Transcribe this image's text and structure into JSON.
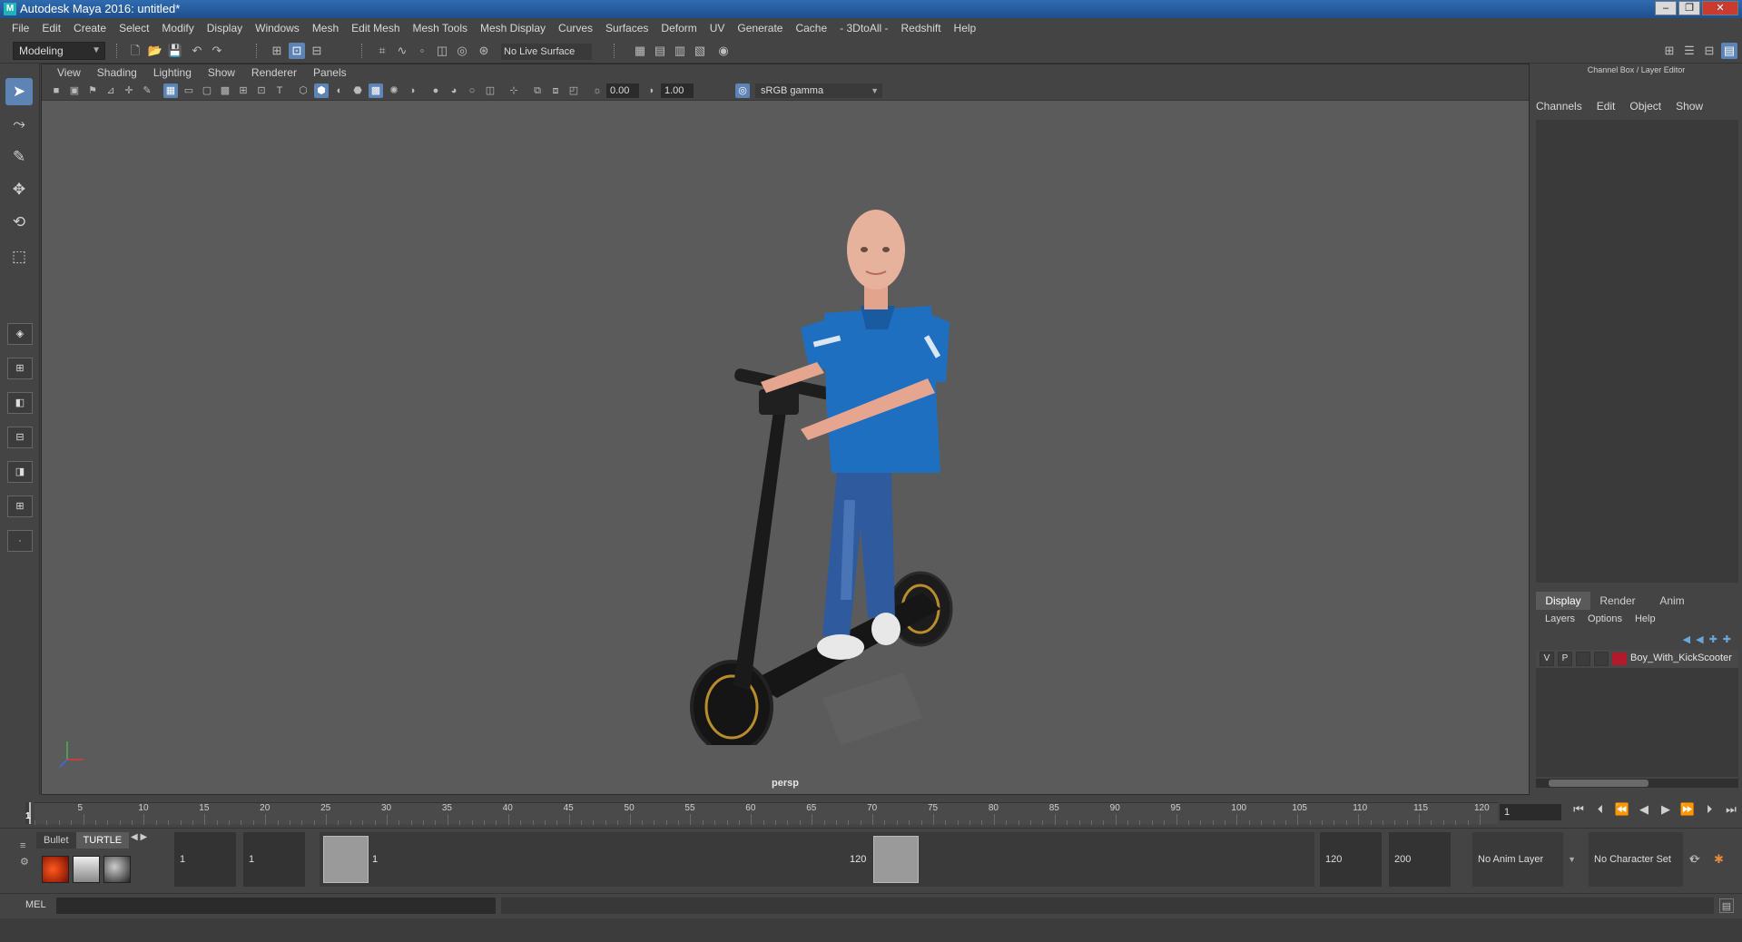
{
  "window": {
    "title": "Autodesk Maya 2016: untitled*",
    "app_icon": "M",
    "controls": [
      "–",
      "❐",
      "✕"
    ]
  },
  "menubar": {
    "items": [
      "File",
      "Edit",
      "Create",
      "Select",
      "Modify",
      "Display",
      "Windows",
      "Mesh",
      "Edit Mesh",
      "Mesh Tools",
      "Mesh Display",
      "Curves",
      "Surfaces",
      "Deform",
      "UV",
      "Generate",
      "Cache",
      "- 3DtoAll -",
      "Redshift",
      "Help"
    ]
  },
  "statusline": {
    "mode": "Modeling",
    "live_surface": "No Live Surface"
  },
  "viewport": {
    "menu": [
      "View",
      "Shading",
      "Lighting",
      "Show",
      "Renderer",
      "Panels"
    ],
    "exposure": "0.00",
    "gamma": "1.00",
    "color_space": "sRGB gamma",
    "camera": "persp"
  },
  "channel_box": {
    "header": "Channel Box / Layer Editor",
    "menu": [
      "Channels",
      "Edit",
      "Object",
      "Show"
    ]
  },
  "layer_editor": {
    "tabs": [
      "Display",
      "Render",
      "Anim"
    ],
    "active_tab": "Display",
    "menu": [
      "Layers",
      "Options",
      "Help"
    ],
    "layers": [
      {
        "visible": "V",
        "playback": "P",
        "name": "Boy_With_KickScooter",
        "color": "#b2192b"
      }
    ]
  },
  "time_slider": {
    "ticks": [
      "1",
      "5",
      "10",
      "15",
      "20",
      "25",
      "30",
      "35",
      "40",
      "45",
      "50",
      "55",
      "60",
      "65",
      "70",
      "75",
      "80",
      "85",
      "90",
      "95",
      "100",
      "105",
      "110",
      "115",
      "120"
    ],
    "current_frame": "1",
    "current_frame_field": "1"
  },
  "range_slider": {
    "start_time": "1",
    "playback_start": "1",
    "range_start_label": "1",
    "range_end_label": "120",
    "playback_end": "120",
    "end_time": "200",
    "anim_layer": "No Anim Layer",
    "character_set": "No Character Set"
  },
  "shelf": {
    "tabs": [
      "Bullet",
      "TURTLE"
    ],
    "active_tab": "TURTLE"
  },
  "command_line": {
    "label": "MEL",
    "value": ""
  },
  "colors": {
    "accent": "#5d84b5",
    "maya_teal": "#1fb5b8",
    "key_orange": "#e08a3c"
  }
}
